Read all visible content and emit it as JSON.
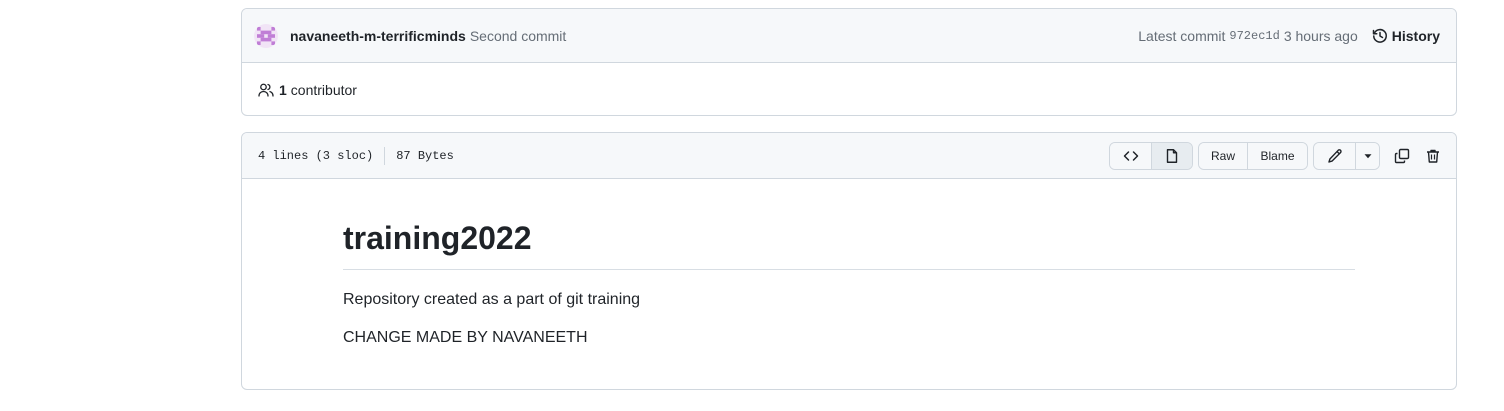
{
  "commit": {
    "author": "navaneeth-m-terrificminds",
    "message": "Second commit",
    "latest_label": "Latest commit",
    "sha": "972ec1d",
    "time": "3 hours ago",
    "history_label": "History"
  },
  "contributors": {
    "count": "1",
    "label": "contributor"
  },
  "file": {
    "lines": "4 lines (3 sloc)",
    "size": "87 Bytes",
    "raw_label": "Raw",
    "blame_label": "Blame"
  },
  "content": {
    "heading": "training2022",
    "paragraphs": [
      "Repository created as a part of git training",
      "CHANGE MADE BY NAVANEETH"
    ]
  },
  "colors": {
    "border": "#d0d7de",
    "header_bg": "#f6f8fa",
    "muted_text": "#656d76",
    "avatar": "#c07ed6"
  }
}
